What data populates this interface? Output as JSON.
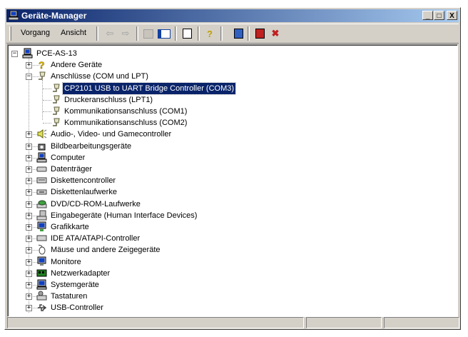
{
  "window": {
    "title": "Geräte-Manager",
    "minimize": "_",
    "maximize": "□",
    "close": "X"
  },
  "menu": {
    "action": "Vorgang",
    "view": "Ansicht"
  },
  "toolbar": [
    "back-icon",
    "forward-icon",
    "up-icon",
    "show-hide-tree-icon",
    "properties-icon",
    "help-icon",
    "scan-hardware-icon",
    "disable-device-icon",
    "uninstall-icon"
  ],
  "tree": {
    "root": "PCE-AS-13",
    "items": [
      {
        "label": "Andere Geräte",
        "level": 1,
        "expander": "+",
        "icon": "unknown-device-icon"
      },
      {
        "label": "Anschlüsse (COM und LPT)",
        "level": 1,
        "expander": "-",
        "icon": "port-icon"
      },
      {
        "label": "CP2101 USB to UART Bridge Controller (COM3)",
        "level": 2,
        "selected": true,
        "icon": "port-icon"
      },
      {
        "label": "Druckeranschluss (LPT1)",
        "level": 2,
        "icon": "port-icon"
      },
      {
        "label": "Kommunikationsanschluss (COM1)",
        "level": 2,
        "icon": "port-icon"
      },
      {
        "label": "Kommunikationsanschluss (COM2)",
        "level": 2,
        "icon": "port-icon"
      },
      {
        "label": "Audio-, Video- und Gamecontroller",
        "level": 1,
        "expander": "+",
        "icon": "speaker-icon"
      },
      {
        "label": "Bildbearbeitungsgeräte",
        "level": 1,
        "expander": "+",
        "icon": "camera-icon"
      },
      {
        "label": "Computer",
        "level": 1,
        "expander": "+",
        "icon": "computer-icon"
      },
      {
        "label": "Datenträger",
        "level": 1,
        "expander": "+",
        "icon": "disk-drive-icon"
      },
      {
        "label": "Diskettencontroller",
        "level": 1,
        "expander": "+",
        "icon": "floppy-controller-icon"
      },
      {
        "label": "Diskettenlaufwerke",
        "level": 1,
        "expander": "+",
        "icon": "floppy-drive-icon"
      },
      {
        "label": "DVD/CD-ROM-Laufwerke",
        "level": 1,
        "expander": "+",
        "icon": "cdrom-icon"
      },
      {
        "label": "Eingabegeräte (Human Interface Devices)",
        "level": 1,
        "expander": "+",
        "icon": "hid-icon"
      },
      {
        "label": "Grafikkarte",
        "level": 1,
        "expander": "+",
        "icon": "display-adapter-icon"
      },
      {
        "label": "IDE ATA/ATAPI-Controller",
        "level": 1,
        "expander": "+",
        "icon": "ide-controller-icon"
      },
      {
        "label": "Mäuse und andere Zeigegeräte",
        "level": 1,
        "expander": "+",
        "icon": "mouse-icon"
      },
      {
        "label": "Monitore",
        "level": 1,
        "expander": "+",
        "icon": "monitor-icon"
      },
      {
        "label": "Netzwerkadapter",
        "level": 1,
        "expander": "+",
        "icon": "network-adapter-icon"
      },
      {
        "label": "Systemgeräte",
        "level": 1,
        "expander": "+",
        "icon": "system-device-icon"
      },
      {
        "label": "Tastaturen",
        "level": 1,
        "expander": "+",
        "icon": "keyboard-icon"
      },
      {
        "label": "USB-Controller",
        "level": 1,
        "expander": "+",
        "icon": "usb-icon"
      }
    ]
  }
}
